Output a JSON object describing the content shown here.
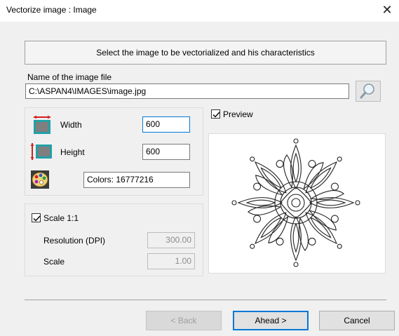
{
  "window": {
    "title": "Vectorize image : Image",
    "close_glyph": "✕"
  },
  "banner": {
    "text": "Select the image to be vectorialized and his characteristics"
  },
  "file": {
    "label": "Name of the image file",
    "value": "C:\\ASPAN4\\IMAGES\\image.jpg",
    "browse_icon": "search-icon"
  },
  "dimensions": {
    "width_label": "Width",
    "width_value": "600",
    "height_label": "Height",
    "height_value": "600",
    "colors_text": "Colors: 16777216"
  },
  "scale": {
    "checkbox_label": "Scale 1:1",
    "checked": true,
    "resolution_label": "Resolution (DPI)",
    "resolution_value": "300.00",
    "scale_label": "Scale",
    "scale_value": "1.00"
  },
  "preview": {
    "checkbox_label": "Preview",
    "checked": true
  },
  "buttons": {
    "back": "< Back",
    "ahead": "Ahead >",
    "cancel": "Cancel"
  },
  "colors": {
    "accent": "#0078d7",
    "icon_red": "#d42020",
    "icon_teal": "#22a0a8"
  }
}
